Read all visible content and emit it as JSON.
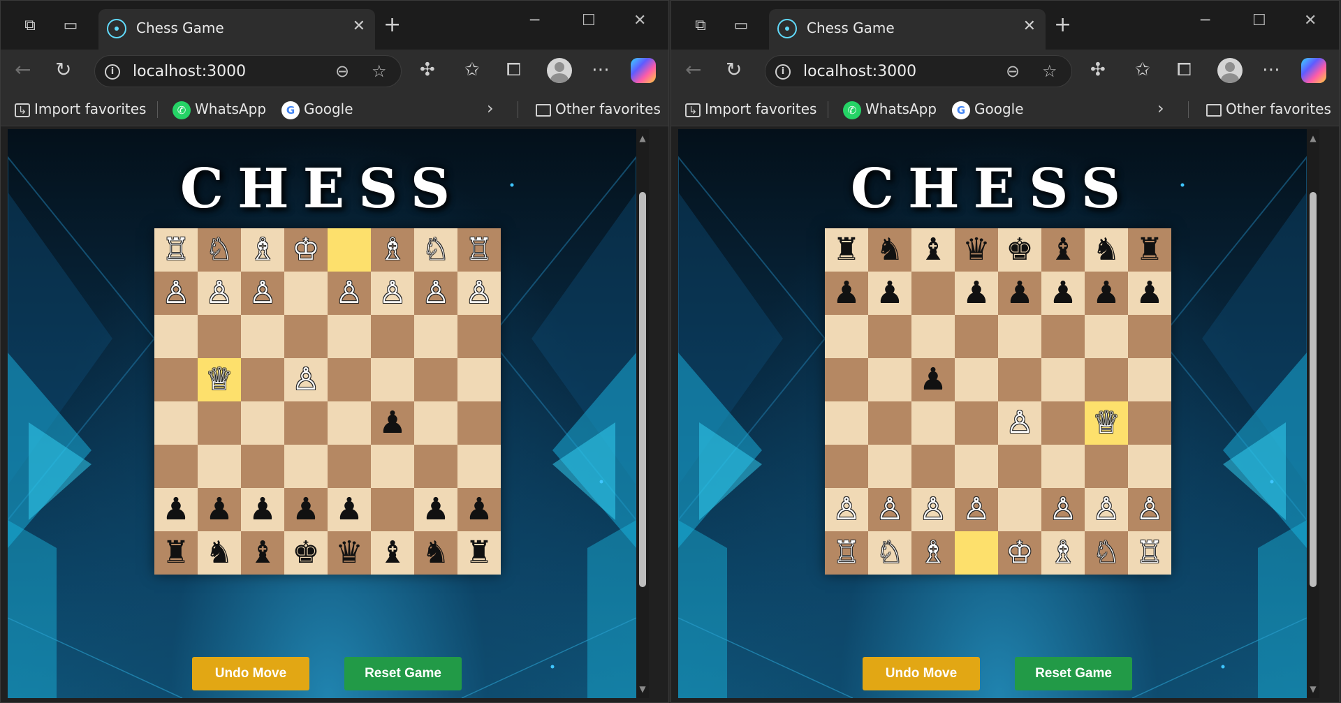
{
  "windows": [
    {
      "tab_title": "Chess Game",
      "url": "localhost:3000",
      "favorites": [
        "Import favorites",
        "WhatsApp",
        "Google"
      ],
      "other_favorites": "Other favorites",
      "game_title": "CHESS",
      "undo_label": "Undo Move",
      "reset_label": "Reset Game",
      "scroll_thumb": {
        "top_fraction": 0.09,
        "size_fraction": 0.73
      },
      "board": [
        [
          "wR",
          "wN",
          "wB",
          "wK",
          "",
          "wB",
          "wN",
          "wR"
        ],
        [
          "wP",
          "wP",
          "wP",
          "",
          "wP",
          "wP",
          "wP",
          "wP"
        ],
        [
          "",
          "",
          "",
          "",
          "",
          "",
          "",
          ""
        ],
        [
          "",
          "wQ",
          "",
          "wP",
          "",
          "",
          "",
          ""
        ],
        [
          "",
          "",
          "",
          "",
          "",
          "bP",
          "",
          ""
        ],
        [
          "",
          "",
          "",
          "",
          "",
          "",
          "",
          ""
        ],
        [
          "bP",
          "bP",
          "bP",
          "bP",
          "bP",
          "",
          "bP",
          "bP"
        ],
        [
          "bR",
          "bN",
          "bB",
          "bK",
          "bQ",
          "bB",
          "bN",
          "bR"
        ]
      ],
      "highlights": [
        [
          0,
          4
        ],
        [
          3,
          1
        ]
      ]
    },
    {
      "tab_title": "Chess Game",
      "url": "localhost:3000",
      "favorites": [
        "Import favorites",
        "WhatsApp",
        "Google"
      ],
      "other_favorites": "Other favorites",
      "game_title": "CHESS",
      "undo_label": "Undo Move",
      "reset_label": "Reset Game",
      "scroll_thumb": {
        "top_fraction": 0.09,
        "size_fraction": 0.73
      },
      "board": [
        [
          "bR",
          "bN",
          "bB",
          "bQ",
          "bK",
          "bB",
          "bN",
          "bR"
        ],
        [
          "bP",
          "bP",
          "",
          "bP",
          "bP",
          "bP",
          "bP",
          "bP"
        ],
        [
          "",
          "",
          "",
          "",
          "",
          "",
          "",
          ""
        ],
        [
          "",
          "",
          "bP",
          "",
          "",
          "",
          "",
          ""
        ],
        [
          "",
          "",
          "",
          "",
          "wP",
          "",
          "wQ",
          ""
        ],
        [
          "",
          "",
          "",
          "",
          "",
          "",
          "",
          ""
        ],
        [
          "wP",
          "wP",
          "wP",
          "wP",
          "",
          "wP",
          "wP",
          "wP"
        ],
        [
          "wR",
          "wN",
          "wB",
          "",
          "wK",
          "wB",
          "wN",
          "wR"
        ]
      ],
      "highlights": [
        [
          7,
          3
        ],
        [
          4,
          6
        ]
      ]
    }
  ],
  "piece_glyphs": {
    "wK": "♔",
    "wQ": "♕",
    "wR": "♖",
    "wB": "♗",
    "wN": "♘",
    "wP": "♙",
    "bK": "♚",
    "bQ": "♛",
    "bR": "♜",
    "bB": "♝",
    "bN": "♞",
    "bP": "♟"
  },
  "icons": {
    "workspaces": "workspaces-icon",
    "tab_actions": "vertical-tabs-icon",
    "react_favicon": "react-logo-icon",
    "back": "back-arrow-icon",
    "refresh": "refresh-icon",
    "info": "site-info-icon",
    "zoom": "zoom-out-icon",
    "favorite": "star-icon",
    "extensions": "puzzle-icon",
    "favorites_list": "favorites-icon",
    "collections": "collections-icon",
    "profile": "avatar",
    "more": "more-icon",
    "copilot": "copilot-icon"
  },
  "colors": {
    "light_square": "#f0d9b5",
    "dark_square": "#b58863",
    "highlight": "#fde06c",
    "undo_button": "#e2a714",
    "reset_button": "#229a47"
  }
}
